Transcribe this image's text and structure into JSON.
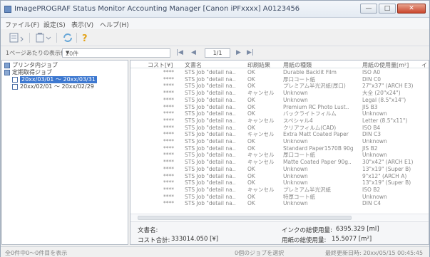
{
  "window": {
    "title": "ImagePROGRAF Status Monitor Accounting Manager [Canon iPFxxxx] A0123456",
    "min_glyph": "—",
    "max_glyph": "□",
    "close_glyph": "✕"
  },
  "menu": {
    "items": [
      "ファイル(F)",
      "設定(S)",
      "表示(V)",
      "ヘルプ(H)"
    ]
  },
  "pager": {
    "label": "1ページあたりの表示件数:",
    "per_page": "20件",
    "page_box": "1/1",
    "first": "|◀",
    "prev": "◀",
    "next": "▶",
    "last": "▶|"
  },
  "tree": {
    "items": [
      {
        "label": "プリンタ内ジョブ"
      },
      {
        "label": "定期取得ジョブ"
      },
      {
        "label": "20xx/03/01 ～ 20xx/03/31"
      },
      {
        "label": "20xx/02/01 ～ 20xx/02/29"
      }
    ]
  },
  "table": {
    "headers": [
      "コスト[¥]",
      "文書名",
      "印刷結果",
      "用紙の種類",
      "用紙の使用量[m²]",
      "イ"
    ],
    "rows": [
      {
        "cost": "****",
        "doc": "STS Job \"detail na..",
        "result": "OK",
        "paper": "Durable Backlit Film",
        "size": "ISO A0"
      },
      {
        "cost": "****",
        "doc": "STS Job \"detail na..",
        "result": "OK",
        "paper": "厚口コート紙",
        "size": "DIN C0"
      },
      {
        "cost": "****",
        "doc": "STS Job \"detail na..",
        "result": "OK",
        "paper": "プレミアム半光沢紙(厚口)",
        "size": "27\"x37\" (ARCH E3)"
      },
      {
        "cost": "****",
        "doc": "STS Job \"detail na..",
        "result": "キャンセル",
        "paper": "Unknown",
        "size": "大全 (20\"x24\")"
      },
      {
        "cost": "****",
        "doc": "STS Job \"detail na..",
        "result": "OK",
        "paper": "Unknown",
        "size": "Legal (8.5\"x14\")"
      },
      {
        "cost": "****",
        "doc": "STS Job \"detail na..",
        "result": "OK",
        "paper": "Premium RC Photo Lust..",
        "size": "JIS B3"
      },
      {
        "cost": "****",
        "doc": "STS Job \"detail na..",
        "result": "OK",
        "paper": "バックライトフィルム",
        "size": "Unknown"
      },
      {
        "cost": "****",
        "doc": "STS Job \"detail na..",
        "result": "キャンセル",
        "paper": "スペシャル4",
        "size": "Letter (8.5\"x11\")"
      },
      {
        "cost": "****",
        "doc": "STS Job \"detail na..",
        "result": "OK",
        "paper": "クリアフィルム(CAD)",
        "size": "ISO B4"
      },
      {
        "cost": "****",
        "doc": "STS Job \"detail na..",
        "result": "キャンセル",
        "paper": "Extra Matt Coated Paper",
        "size": "DIN C3"
      },
      {
        "cost": "****",
        "doc": "STS Job \"detail na..",
        "result": "OK",
        "paper": "Unknown",
        "size": "Unknown"
      },
      {
        "cost": "****",
        "doc": "STS Job \"detail na..",
        "result": "OK",
        "paper": "Standard Paper1570B 90g",
        "size": "JIS B2"
      },
      {
        "cost": "****",
        "doc": "STS Job \"detail na..",
        "result": "キャンセル",
        "paper": "厚口コート紙",
        "size": "Unknown"
      },
      {
        "cost": "****",
        "doc": "STS Job \"detail na..",
        "result": "キャンセル",
        "paper": "Matte Coated Paper 90g..",
        "size": "30\"x42\" (ARCH E1)"
      },
      {
        "cost": "****",
        "doc": "STS Job \"detail na..",
        "result": "OK",
        "paper": "Unknown",
        "size": "13\"x19\" (Super B)"
      },
      {
        "cost": "****",
        "doc": "STS Job \"detail na..",
        "result": "OK",
        "paper": "Unknown",
        "size": "9\"x12\" (ARCH A)"
      },
      {
        "cost": "****",
        "doc": "STS Job \"detail na..",
        "result": "OK",
        "paper": "Unknown",
        "size": "13\"x19\" (Super B)"
      },
      {
        "cost": "****",
        "doc": "STS Job \"detail na..",
        "result": "キャンセル",
        "paper": "プレミアム半光沢紙",
        "size": "ISO B2"
      },
      {
        "cost": "****",
        "doc": "STS Job \"detail na..",
        "result": "OK",
        "paper": "特厚コート紙",
        "size": "Unknown"
      },
      {
        "cost": "****",
        "doc": "STS Job \"detail na..",
        "result": "OK",
        "paper": "Unknown",
        "size": "DIN C4"
      }
    ]
  },
  "summary": {
    "doc_label": "文書名:",
    "cost_total_label": "コスト合計:",
    "cost_total_value": "333014.050 [¥]",
    "ink_label": "インクの総使用量:",
    "ink_value": "6395.329 [ml]",
    "paper_label": "用紙の総使用量:",
    "paper_value": "15.5077 [m²]"
  },
  "status": {
    "left": "全0件中0～0件目を表示",
    "center": "0個のジョブを選択",
    "right": "最終更新日時: 20xx/05/15 00:45:45"
  },
  "colors": {
    "selection": "#3d78d0",
    "close_button": "#c9462d"
  }
}
